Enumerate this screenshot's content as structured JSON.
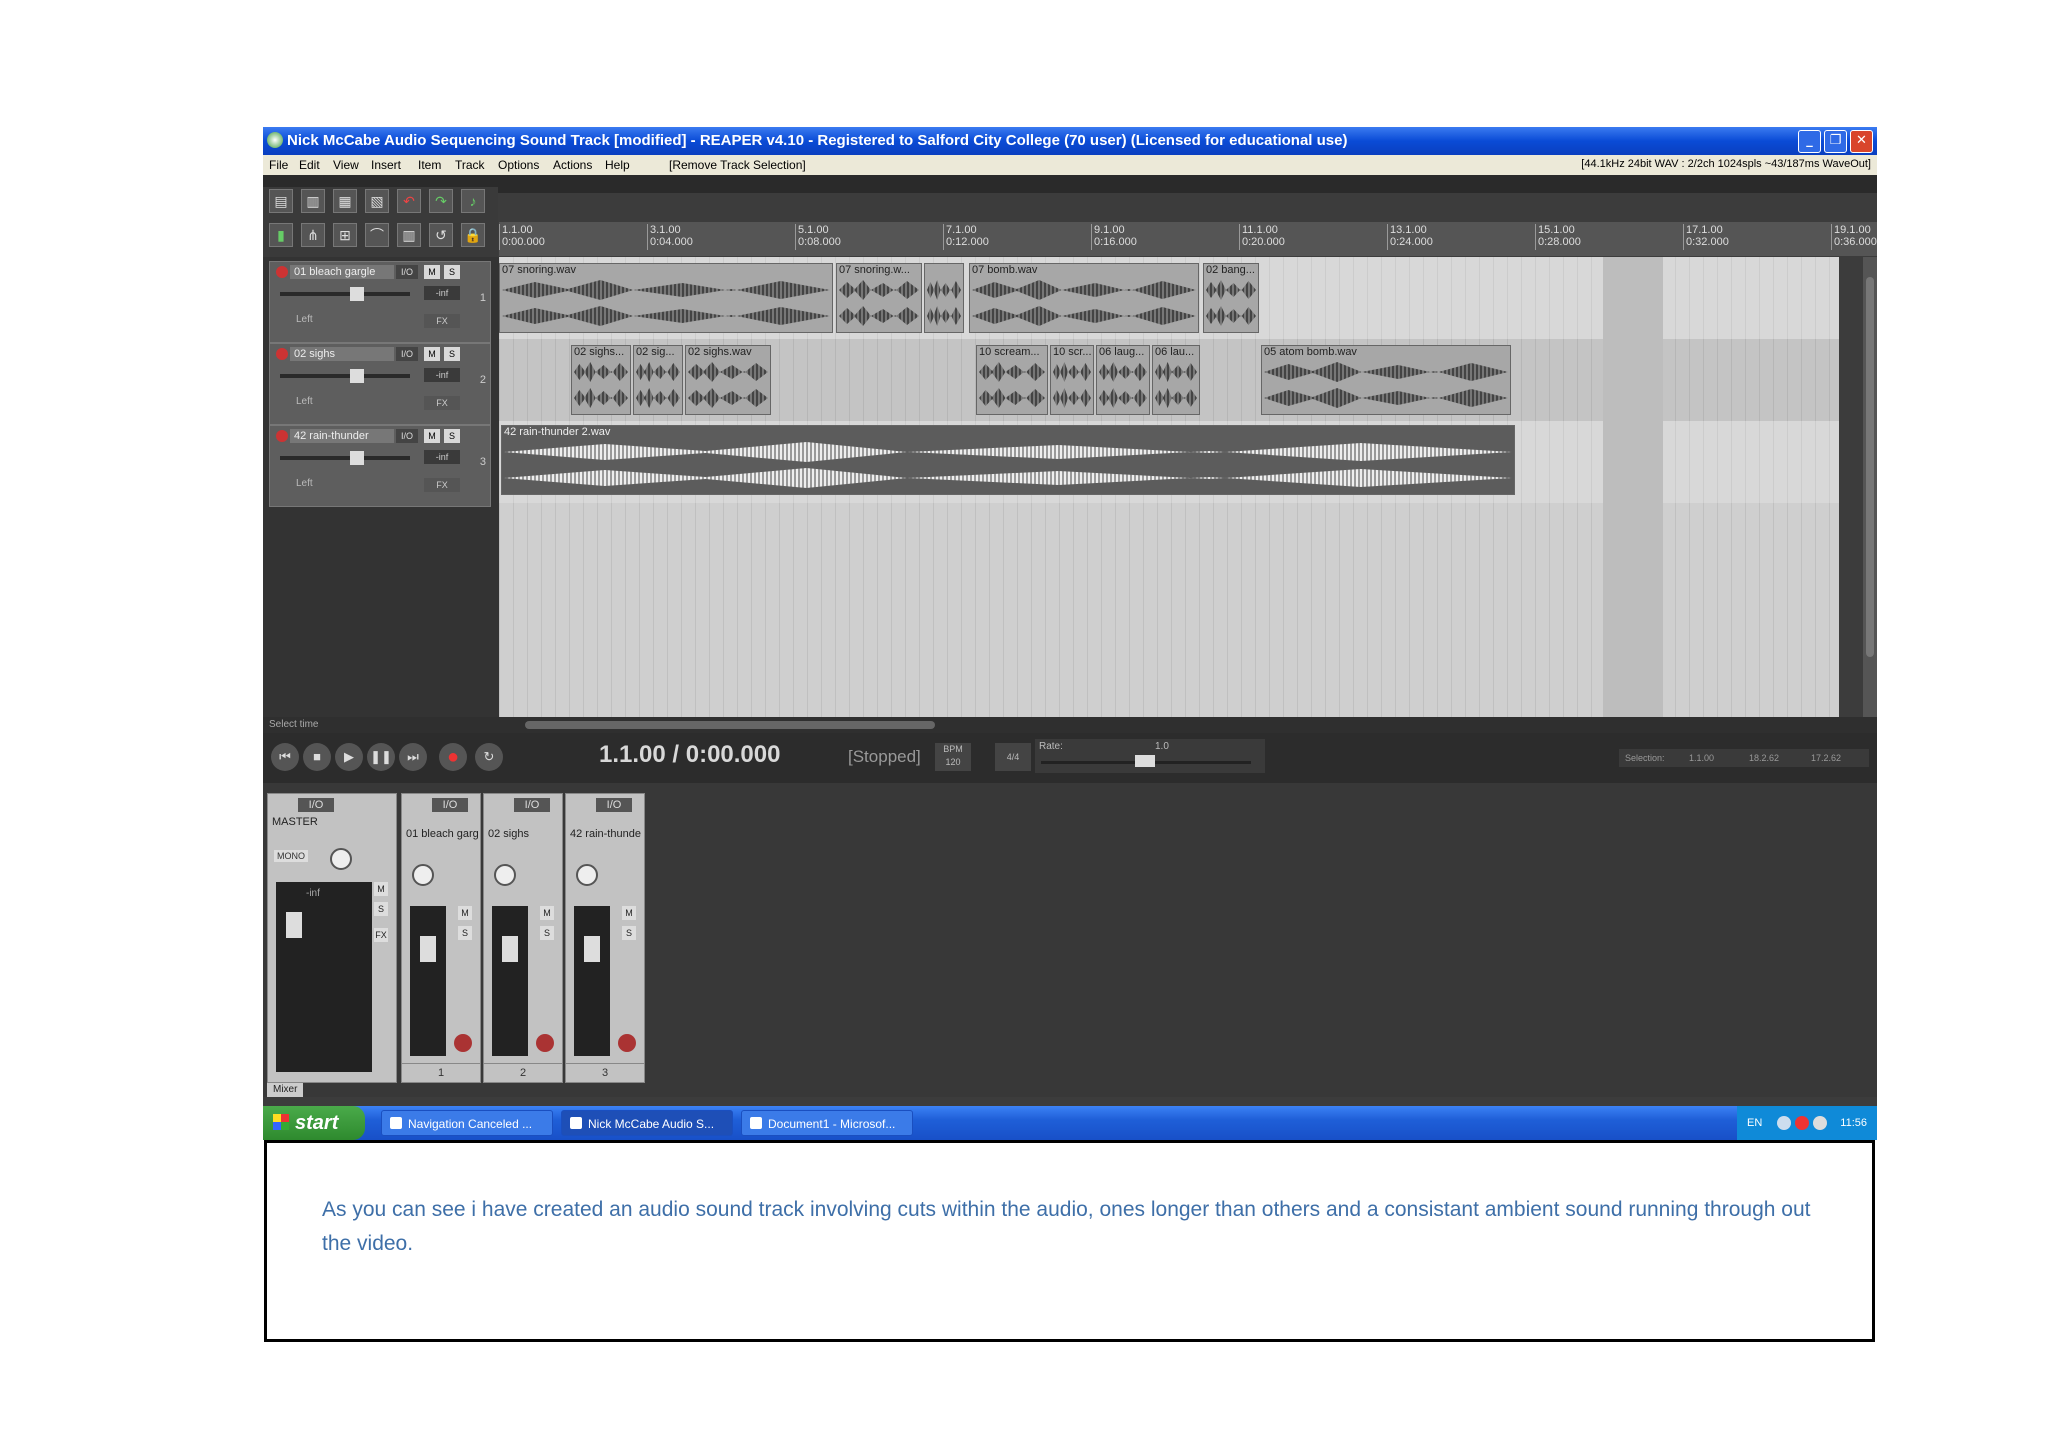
{
  "window": {
    "title": "Nick McCabe Audio Sequencing Sound Track [modified] - REAPER v4.10 - Registered to Salford City College (70 user) (Licensed for educational use)",
    "minimize": "_",
    "maximize": "❐",
    "close": "✕"
  },
  "menu": {
    "items": [
      "File",
      "Edit",
      "View",
      "Insert",
      "Item",
      "Track",
      "Options",
      "Actions",
      "Help",
      "[Remove Track Selection]"
    ],
    "status": "[44.1kHz 24bit WAV : 2/2ch 1024spls ~43/187ms WaveOut]"
  },
  "ruler": {
    "marks": [
      {
        "bar": "1.1.00",
        "time": "0:00.000"
      },
      {
        "bar": "3.1.00",
        "time": "0:04.000"
      },
      {
        "bar": "5.1.00",
        "time": "0:08.000"
      },
      {
        "bar": "7.1.00",
        "time": "0:12.000"
      },
      {
        "bar": "9.1.00",
        "time": "0:16.000"
      },
      {
        "bar": "11.1.00",
        "time": "0:20.000"
      },
      {
        "bar": "13.1.00",
        "time": "0:24.000"
      },
      {
        "bar": "15.1.00",
        "time": "0:28.000"
      },
      {
        "bar": "17.1.00",
        "time": "0:32.000"
      },
      {
        "bar": "19.1.00",
        "time": "0:36.000"
      }
    ]
  },
  "tracks": [
    {
      "name": "01 bleach gargle",
      "io": "I/O",
      "mute": "M",
      "solo": "S",
      "vol": "-inf",
      "pan": "Left",
      "fx": "FX",
      "num": "1"
    },
    {
      "name": "02 sighs",
      "io": "I/O",
      "mute": "M",
      "solo": "S",
      "vol": "-inf",
      "pan": "Left",
      "fx": "FX",
      "num": "2"
    },
    {
      "name": "42 rain-thunder",
      "io": "I/O",
      "mute": "M",
      "solo": "S",
      "vol": "-inf",
      "pan": "Left",
      "fx": "FX",
      "num": "3"
    }
  ],
  "items": {
    "t1": [
      "07 snoring.wav",
      "07 snoring.w...",
      "07 bomb.wav",
      "02 bang..."
    ],
    "t2": [
      "02 sighs...",
      "02 sig...",
      "02 sighs.wav",
      "10 scream...",
      "10 scr...",
      "06 laug...",
      "06 lau...",
      "05 atom bomb.wav"
    ],
    "t3": [
      "42 rain-thunder 2.wav"
    ]
  },
  "hscroll": {
    "hint": "Select time"
  },
  "transport": {
    "buttons": [
      "⏮",
      "■",
      "▶",
      "❚❚",
      "⏭",
      "●",
      "↻"
    ],
    "time": "1.1.00 / 0:00.000",
    "state": "[Stopped]",
    "bpm_label": "BPM",
    "bpm": "120",
    "timesig": "4/4",
    "rate_label": "Rate:",
    "rate": "1.0",
    "selection": {
      "label": "Selection:",
      "start": "1.1.00",
      "end": "18.2.62",
      "length": "17.2.62"
    }
  },
  "mixer": {
    "master": {
      "io": "I/O",
      "name": "MASTER",
      "mono": "MONO",
      "vol": "-inf",
      "fx": "FX"
    },
    "channels": [
      {
        "io": "I/O",
        "name": "01 bleach garg",
        "num": "1"
      },
      {
        "io": "I/O",
        "name": "02 sighs",
        "num": "2"
      },
      {
        "io": "I/O",
        "name": "42 rain-thunde",
        "num": "3"
      }
    ],
    "tab": "Mixer"
  },
  "taskbar": {
    "start": "start",
    "tasks": [
      "Navigation Canceled ...",
      "Nick McCabe Audio S...",
      "Document1 - Microsof..."
    ],
    "lang": "EN",
    "clock": "11:56"
  },
  "caption": "As you can see i have created an audio sound track involving cuts within the audio, ones longer than others and a consistant ambient sound running through out the video."
}
